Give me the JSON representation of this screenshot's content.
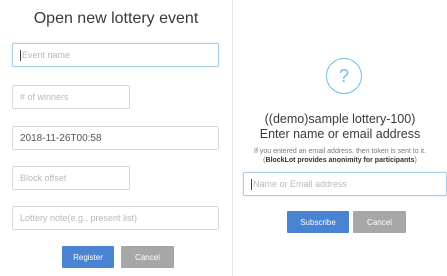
{
  "left_form": {
    "title": "Open new lottery event",
    "event_name_placeholder": "Event name",
    "winners_placeholder": "# of winners",
    "datetime_value": "2018-11-26T00:58",
    "block_offset_placeholder": "Block offset",
    "lottery_note_placeholder": "Lottery note(e.g., present list)",
    "register_label": "Register",
    "cancel_label": "Cancel"
  },
  "right_form": {
    "icon": "question-icon",
    "icon_glyph": "?",
    "title_line1": "((demo)sample lottery-100)",
    "title_line2": "Enter name or email address",
    "info_line1": "If you entered an email address, then token is sent to it.",
    "info_line2_prefix": "(",
    "info_line2_bold": "BlockLot provides anonimity for participants",
    "info_line2_suffix": ")",
    "input_placeholder": "Name or Email address",
    "subscribe_label": "Subscribe",
    "cancel_label": "Cancel"
  },
  "colors": {
    "primary": "#4a83d1",
    "secondary": "#a7a7a7",
    "accent": "#6ec0e8"
  }
}
